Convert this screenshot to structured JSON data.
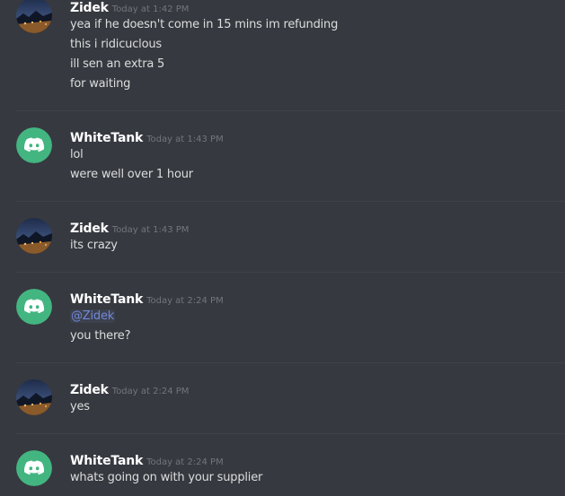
{
  "colors": {
    "background": "#36393f",
    "username": "#ffffff",
    "timestamp": "#72767d",
    "message_text": "#dcddde",
    "mention": "#7289da",
    "discord_avatar_bg": "#43b581"
  },
  "messages": [
    {
      "author": "Zidek",
      "avatar": "landscape-photo-avatar",
      "timestamp": "Today at 1:42 PM",
      "lines": [
        "yea if he doesn't come in 15 mins im refunding",
        "this i ridicuclous",
        "ill sen an extra 5",
        "for waiting"
      ]
    },
    {
      "author": "WhiteTank",
      "avatar": "discord-logo-avatar",
      "timestamp": "Today at 1:43 PM",
      "lines": [
        "lol",
        "were well over 1 hour"
      ]
    },
    {
      "author": "Zidek",
      "avatar": "landscape-photo-avatar",
      "timestamp": "Today at 1:43 PM",
      "lines": [
        "its crazy"
      ]
    },
    {
      "author": "WhiteTank",
      "avatar": "discord-logo-avatar",
      "timestamp": "Today at 2:24 PM",
      "mention": "@Zidek",
      "lines": [
        "you there?"
      ]
    },
    {
      "author": "Zidek",
      "avatar": "landscape-photo-avatar",
      "timestamp": "Today at 2:24 PM",
      "lines": [
        "yes"
      ]
    },
    {
      "author": "WhiteTank",
      "avatar": "discord-logo-avatar",
      "timestamp": "Today at 2:24 PM",
      "lines": [
        "whats going on with your supplier"
      ]
    }
  ]
}
